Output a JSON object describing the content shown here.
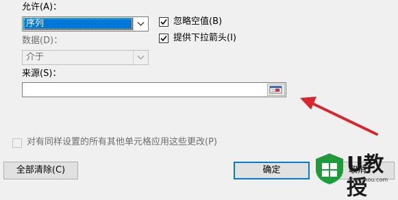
{
  "dialog": {
    "allow_label": "允许(A)：",
    "allow_value": "序列",
    "data_label": "数据(D)：",
    "data_value": "介于",
    "ignore_blank_label": "忽略空值(B)",
    "ignore_blank_checked": true,
    "dropdown_label": "提供下拉箭头(I)",
    "dropdown_checked": true,
    "source_label": "来源(S)：",
    "source_value": "",
    "apply_all_label": "对有同样设置的所有其他单元格应用这些更改(P)",
    "apply_all_checked": false,
    "clear_all_label": "全部清除(C)",
    "ok_label": "确定",
    "cancel_label": "取消"
  },
  "watermark": {
    "brand": "U教授",
    "sub": "ujiaoshou.com"
  },
  "colors": {
    "selection": "#0078d7",
    "arrow": "#d9262c",
    "logo_green": "#1e9b3a"
  },
  "icons": {
    "range_button": "collapse-dialog-icon",
    "annotation": "red-arrow-icon"
  }
}
